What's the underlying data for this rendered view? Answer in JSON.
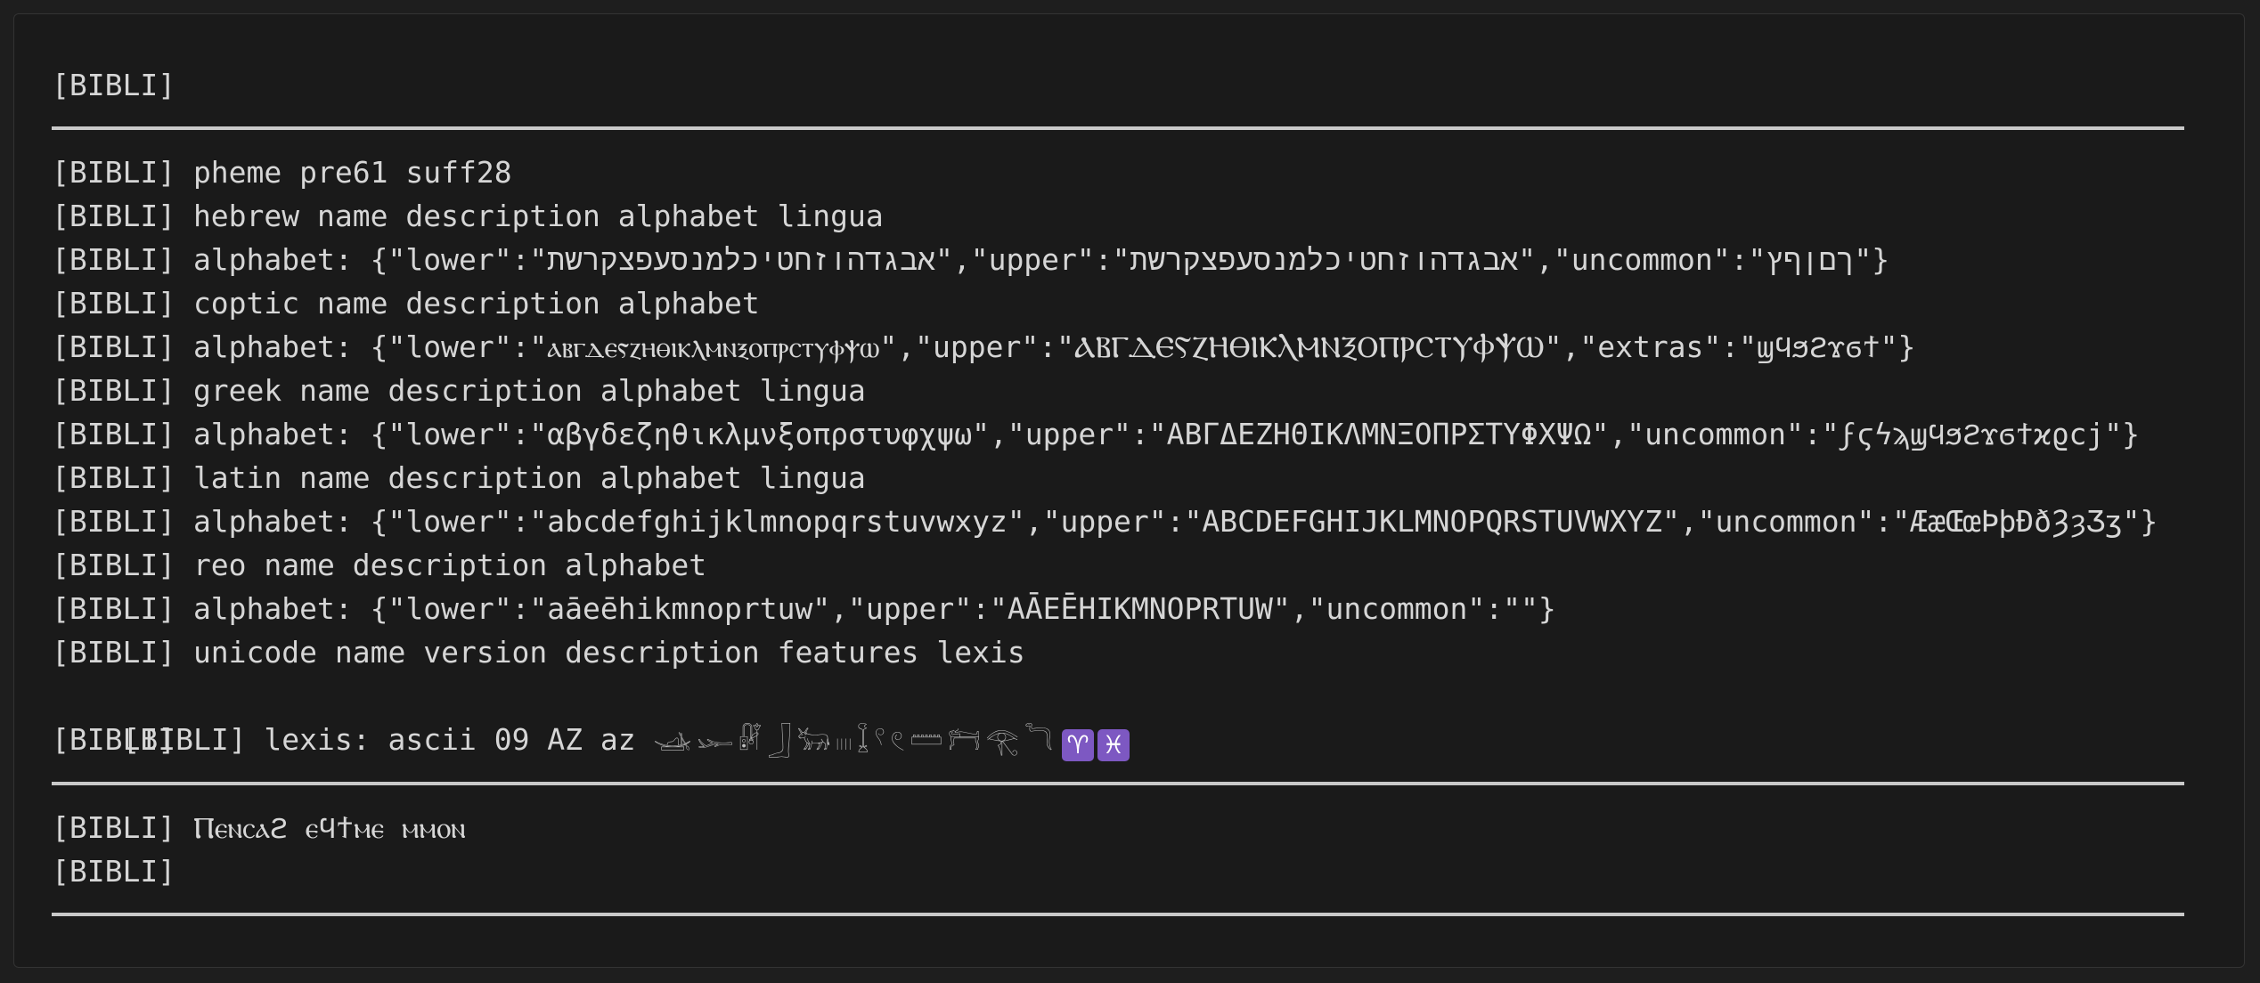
{
  "terminal": {
    "lines": {
      "header": "[BIBLI]",
      "pheme": "[BIBLI] pheme pre61 suff28",
      "hebrew_title": "[BIBLI] hebrew name description alphabet lingua",
      "hebrew_alphabet": "[BIBLI] alphabet: {\"lower\":\"אבגדהוזחטיכלמנסעפצקרשת\",\"upper\":\"אבגדהוזחטיכלמנסעפצקרשת\",\"uncommon\":\"ךםןףץ\"}",
      "coptic_title": "[BIBLI] coptic name description alphabet",
      "coptic_alphabet": "[BIBLI] alphabet: {\"lower\":\"ⲁⲃⲅⲇⲉⲋⲍⲏⲑⲓⲕⲗⲙⲛⲝⲟⲡⲣⲥⲧⲩⲫⲯⲱ\",\"upper\":\"ⲀⲂⲄⲆⲈⲊⲌⲎⲐⲒⲔⲖⲘⲚⲜⲞⲠⲢⲤⲦⲨⲪⲮⲰ\",\"extras\":\"ϣϥϧϩϫϭϯ\"}",
      "greek_title": "[BIBLI] greek name description alphabet lingua",
      "greek_alphabet": "[BIBLI] alphabet: {\"lower\":\"αβγδεζηθικλμνξοπρστυφχψω\",\"upper\":\"ΑΒΓΔΕΖΗΘΙΚΛΜΝΞΟΠΡΣΤΥΦΧΨΩ\",\"uncommon\":\"ϝϛϟϡϣϥϧϩϫϭϯϰϱϲϳ\"}",
      "latin_title": "[BIBLI] latin name description alphabet lingua",
      "latin_alphabet": "[BIBLI] alphabet: {\"lower\":\"abcdefghijklmnopqrstuvwxyz\",\"upper\":\"ABCDEFGHIJKLMNOPQRSTUVWXYZ\",\"uncommon\":\"ÆæŒœÞþÐðȜȝƷʒ\"}",
      "reo_title": "[BIBLI] reo name description alphabet",
      "reo_alphabet": "[BIBLI] alphabet: {\"lower\":\"aāeēhikmnoprtuw\",\"upper\":\"AĀEĒHIKMNOPRTUW\",\"uncommon\":\"\"}",
      "unicode_title": "[BIBLI] unicode name version description features lexis",
      "lexis_prefix": "[BIBLI] lexis: ascii 09 AZ az ",
      "blank_after_lexis": "[BIBLI]",
      "coptic_phrase": "[BIBLI] Ⲡⲉⲛⲥⲁϩ ⲉϥϯⲙⲉ ⲙⲙⲟⲛ",
      "final": "[BIBLI]"
    },
    "lexis_glyphs": [
      "𓊛",
      "𓆱",
      "𓏞",
      "𓃀",
      "𓃒",
      "𓏽",
      "𓆼",
      "𓍢",
      "𓏲",
      "𓏠",
      "𓁀",
      "𓂀",
      "𓆓"
    ],
    "lexis_zodiac": [
      "♈",
      "♓"
    ],
    "colors": {
      "background": "#1a1a1a",
      "text": "#d6d6d6",
      "rule": "#c9c9c9",
      "zodiac_bg": "#7d58c2"
    }
  }
}
